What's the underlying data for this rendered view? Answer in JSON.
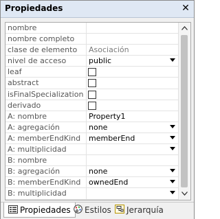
{
  "window": {
    "title": "Propiedades",
    "close": "✕"
  },
  "rows": [
    {
      "name": "nombre",
      "value": "",
      "type": "text"
    },
    {
      "name": "nombre completo",
      "value": "",
      "type": "text"
    },
    {
      "name": "clase de elemento",
      "value": "Asociación",
      "type": "readonly"
    },
    {
      "name": "nivel de acceso",
      "value": "public",
      "type": "dropdown"
    },
    {
      "name": "leaf",
      "value": "",
      "type": "checkbox"
    },
    {
      "name": "abstract",
      "value": "",
      "type": "checkbox"
    },
    {
      "name": "isFinalSpecialization",
      "value": "",
      "type": "checkbox"
    },
    {
      "name": "derivado",
      "value": "",
      "type": "checkbox"
    },
    {
      "name": "A: nombre",
      "value": "Property1",
      "type": "text"
    },
    {
      "name": "A: agregación",
      "value": "none",
      "type": "dropdown"
    },
    {
      "name": "A: memberEndKind",
      "value": "memberEnd",
      "type": "dropdown"
    },
    {
      "name": "A: multiplicidad",
      "value": "",
      "type": "dropdown"
    },
    {
      "name": "B: nombre",
      "value": "",
      "type": "text"
    },
    {
      "name": "B: agregación",
      "value": "none",
      "type": "dropdown"
    },
    {
      "name": "B: memberEndKind",
      "value": "ownedEnd",
      "type": "dropdown"
    },
    {
      "name": "B: multiplicidad",
      "value": "",
      "type": "dropdown"
    }
  ],
  "tabs": [
    {
      "label": "Propiedades",
      "icon": "properties-icon",
      "active": true
    },
    {
      "label": "Estilos",
      "icon": "palette-icon",
      "active": false
    },
    {
      "label": "Jerarquía",
      "icon": "hierarchy-icon",
      "active": false
    }
  ]
}
